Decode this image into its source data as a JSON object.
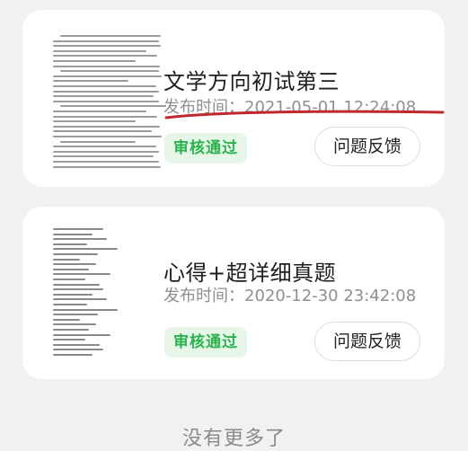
{
  "items": [
    {
      "title": "文学方向初试第三",
      "time": "发布时间：2021-05-01 12:24:08",
      "status": "审核通过",
      "feedback_label": "问题反馈"
    },
    {
      "title": "心得+超详细真题",
      "time": "发布时间：2020-12-30 23:42:08",
      "status": "审核通过",
      "feedback_label": "问题反馈"
    }
  ],
  "footer_text": "没有更多了",
  "colors": {
    "background": "#f1f1f3",
    "status_green": "#2ab14e",
    "status_bg": "#e6f7ea",
    "annotation_red": "#c0282b"
  }
}
